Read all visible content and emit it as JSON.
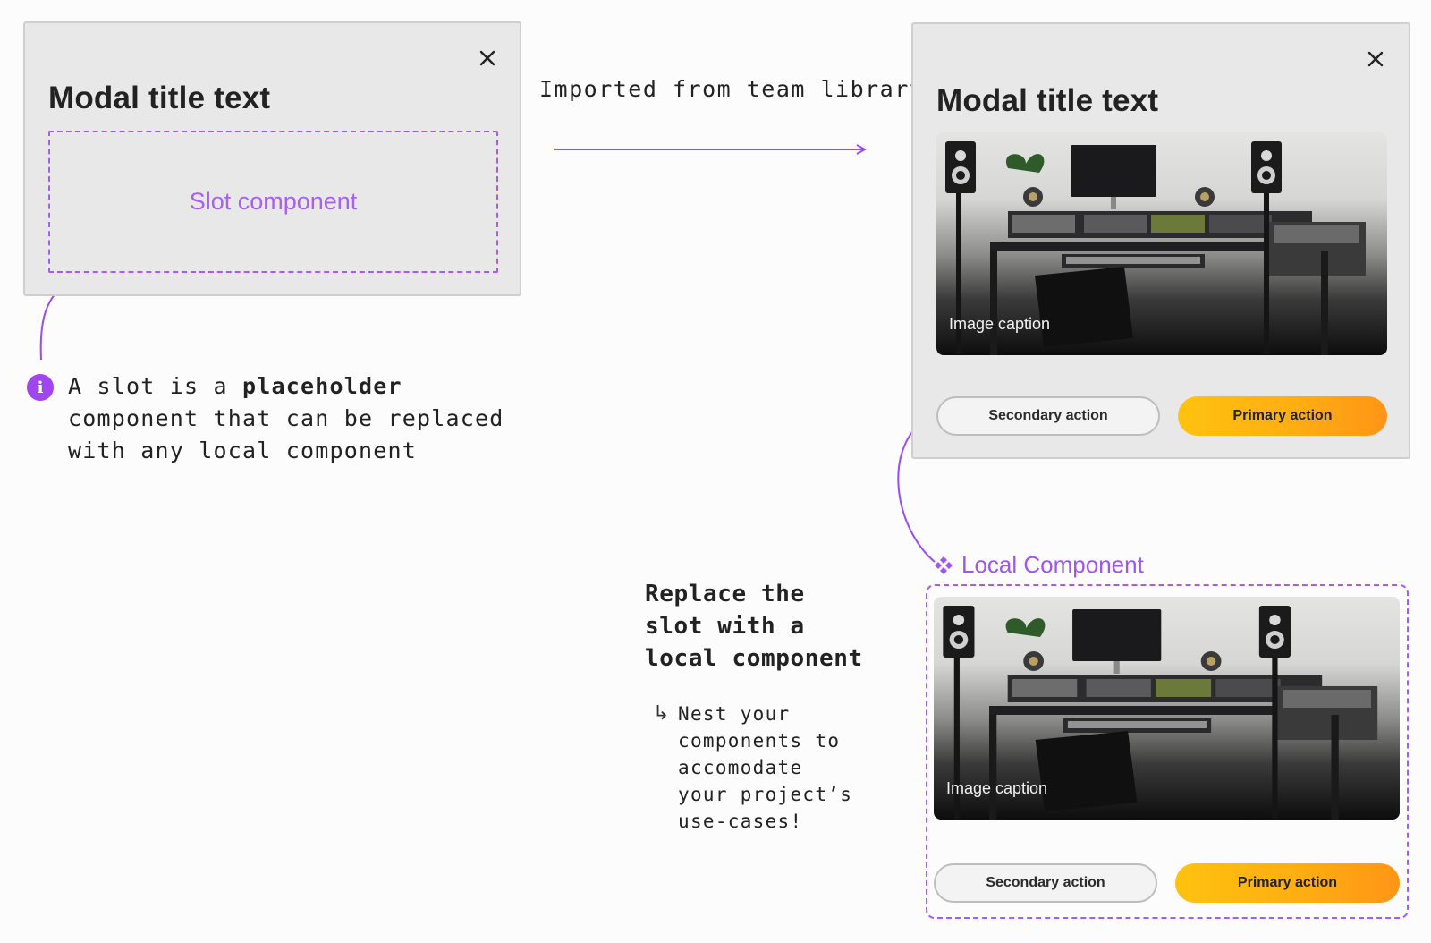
{
  "template_modal": {
    "title": "Modal title text",
    "slot_label": "Slot component"
  },
  "flow": {
    "label": "Imported from team library"
  },
  "result_modal": {
    "title": "Modal title text",
    "image_caption": "Image caption",
    "secondary_label": "Secondary action",
    "primary_label": "Primary action"
  },
  "note": {
    "prefix": "A slot is a ",
    "emphasis": "placeholder",
    "suffix": " component that can be replaced with any local component"
  },
  "local_component": {
    "label": "Local Component",
    "image_caption": "Image caption",
    "secondary_label": "Secondary action",
    "primary_label": "Primary action"
  },
  "instructions": {
    "heading": "Replace the slot with a local component",
    "arrow": "↳",
    "detail": "Nest your components to accomodate your project’s use-cases!"
  },
  "colors": {
    "accent_purple": "#a55cf5",
    "primary_orange": "#ffae12",
    "modal_bg": "#e9e8e9"
  },
  "icons": [
    "close-icon",
    "info-icon",
    "component-icon"
  ]
}
